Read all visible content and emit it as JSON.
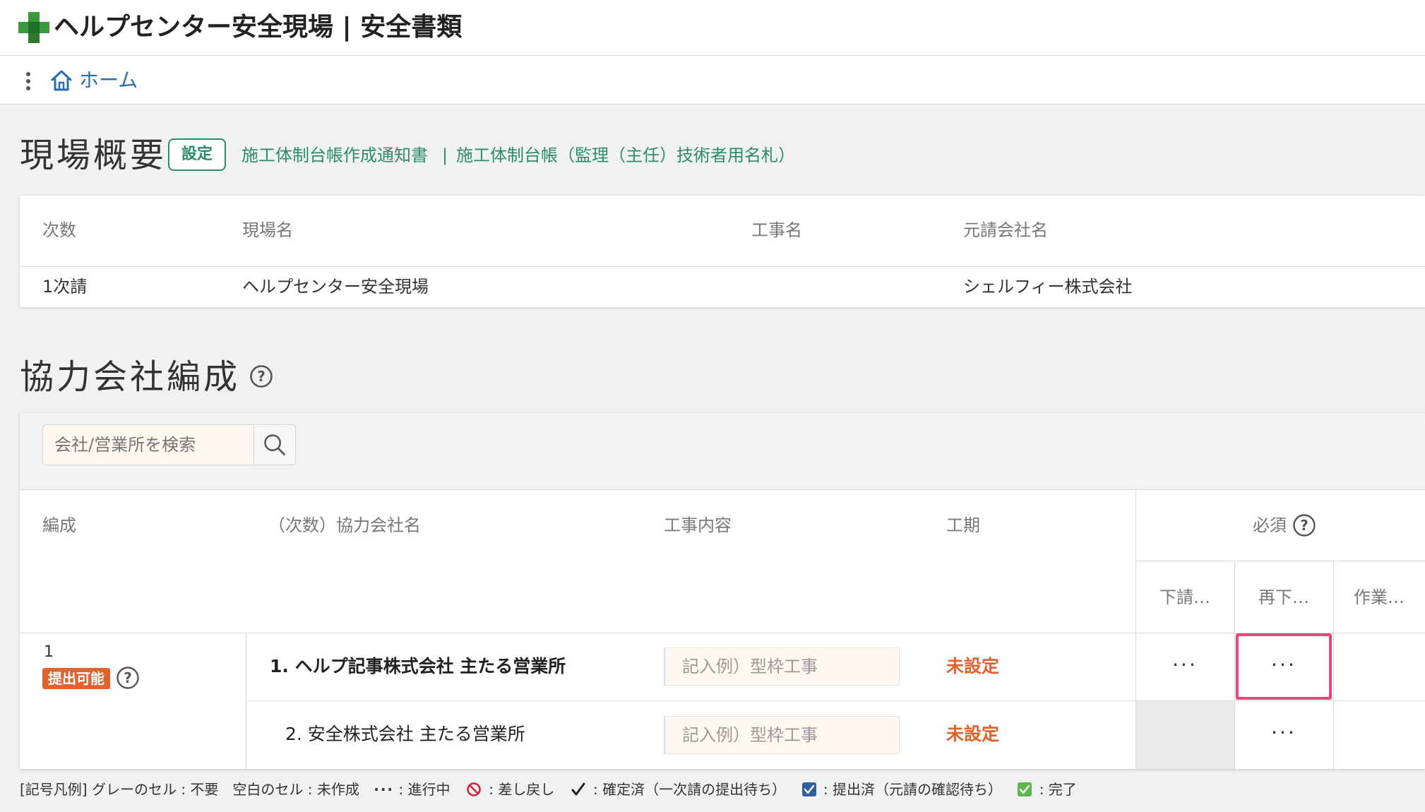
{
  "header": {
    "app_title": "ヘルプセンター安全現場 | 安全書類"
  },
  "nav": {
    "home_label": "ホーム"
  },
  "overview": {
    "title": "現場概要",
    "settings_label": "設定",
    "links": [
      "施工体制台帳作成通知書",
      "施工体制台帳（監理（主任）技術者用名札）"
    ],
    "link_separator": "|",
    "columns": [
      "次数",
      "現場名",
      "工事名",
      "元請会社名"
    ],
    "row": {
      "tier": "1次請",
      "site_name": "ヘルプセンター安全現場",
      "work_name": "",
      "prime_contractor": "シェルフィー株式会社"
    }
  },
  "organization": {
    "title": "協力会社編成",
    "search_placeholder": "会社/営業所を検索",
    "columns": {
      "formation": "編成",
      "company": "（次数）協力会社名",
      "work_content": "工事内容",
      "period": "工期",
      "required": "必須",
      "sub_columns": [
        "下請…",
        "再下…",
        "作業…"
      ]
    },
    "group": {
      "number": "1",
      "status_badge": "提出可能"
    },
    "rows": [
      {
        "company": "1. ヘルプ記事株式会社 主たる営業所",
        "work_placeholder": "記入例）型枠工事",
        "period": "未設定",
        "cell1": "···",
        "cell2": "···"
      },
      {
        "company": "2. 安全株式会社 主たる営業所",
        "work_placeholder": "記入例）型枠工事",
        "period": "未設定",
        "cell2": "···"
      }
    ]
  },
  "legend": {
    "prefix": "[記号凡例] グレーのセル : 不要　空白のセル : 未作成",
    "in_progress_symbol": "···",
    "in_progress": ": 進行中",
    "returned": ": 差し戻し",
    "confirmed": ": 確定済（一次請の提出待ち）",
    "submitted": ": 提出済（元請の確認待ち）",
    "completed": ": 完了"
  },
  "colors": {
    "accent_green": "#2e8b6e",
    "link_blue": "#2b6cb0",
    "warning_orange": "#e2622d",
    "highlight_pink": "#e8457a"
  }
}
